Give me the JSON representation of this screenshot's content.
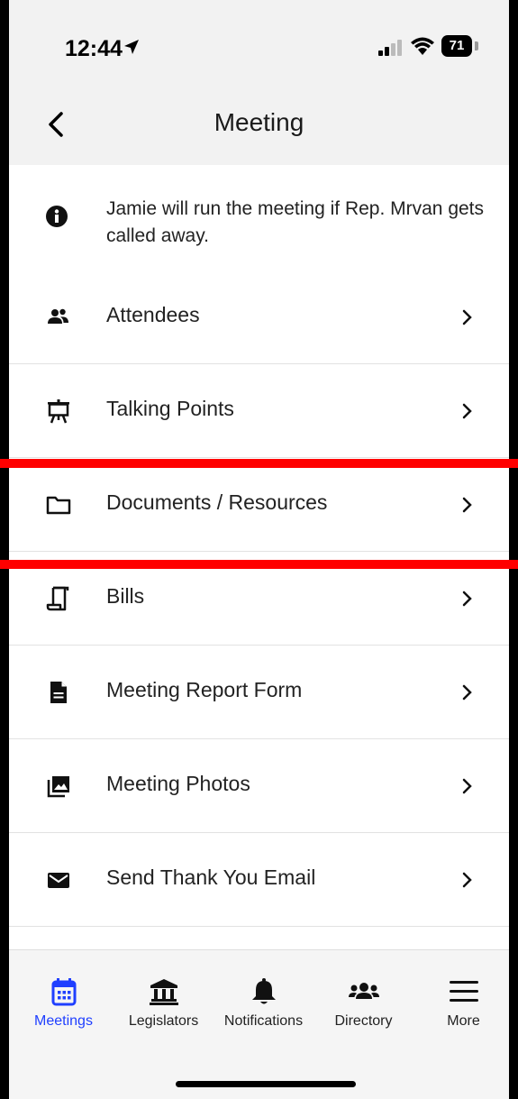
{
  "status_bar": {
    "time": "12:44",
    "battery": "71"
  },
  "header": {
    "title": "Meeting"
  },
  "note": {
    "text": "Jamie will run the meeting if Rep. Mrvan gets called away."
  },
  "menu": [
    {
      "id": "attendees",
      "label": "Attendees",
      "icon": "people-icon"
    },
    {
      "id": "talking-points",
      "label": "Talking Points",
      "icon": "presentation-icon"
    },
    {
      "id": "documents",
      "label": "Documents / Resources",
      "icon": "folder-icon"
    },
    {
      "id": "bills",
      "label": "Bills",
      "icon": "scroll-icon"
    },
    {
      "id": "report",
      "label": "Meeting Report Form",
      "icon": "document-icon"
    },
    {
      "id": "photos",
      "label": "Meeting Photos",
      "icon": "photo-library-icon"
    },
    {
      "id": "email",
      "label": "Send Thank You Email",
      "icon": "envelope-icon"
    }
  ],
  "tabs": [
    {
      "label": "Meetings",
      "icon": "calendar-icon",
      "active": true
    },
    {
      "label": "Legislators",
      "icon": "bank-icon",
      "active": false
    },
    {
      "label": "Notifications",
      "icon": "bell-icon",
      "active": false
    },
    {
      "label": "Directory",
      "icon": "group-icon",
      "active": false
    },
    {
      "label": "More",
      "icon": "menu-icon",
      "active": false
    }
  ],
  "colors": {
    "accent": "#1f3fff",
    "highlight": "#ff0000",
    "background": "#f2f2f2"
  }
}
